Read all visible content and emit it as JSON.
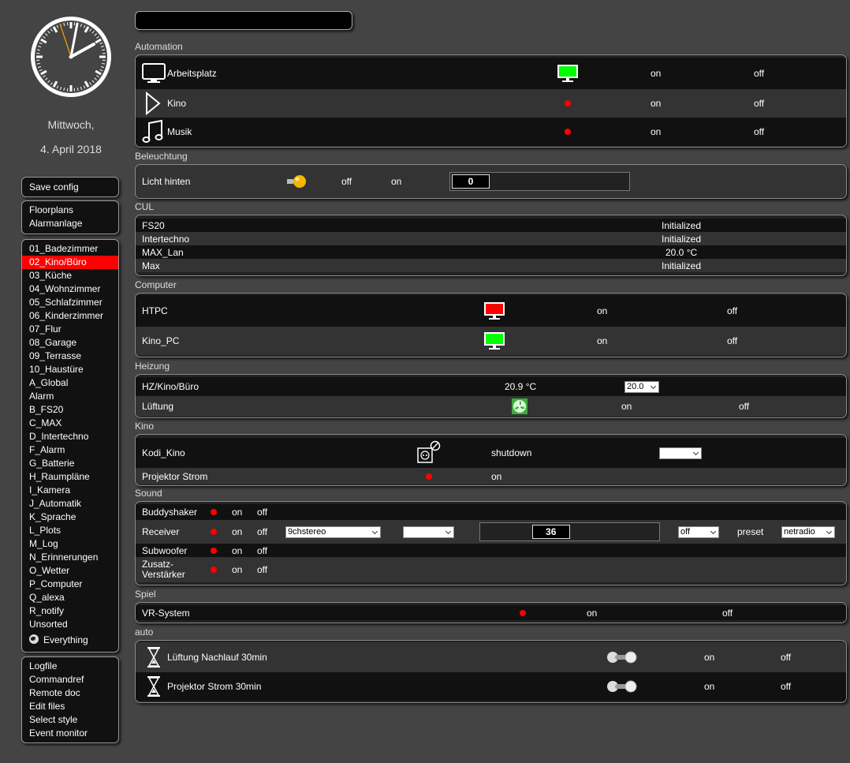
{
  "sidebar": {
    "date": {
      "weekday": "Mittwoch,",
      "date": "4. April 2018"
    },
    "menu_save": [
      "Save config"
    ],
    "menu_top": [
      "Floorplans",
      "Alarmanlage"
    ],
    "rooms": [
      "01_Badezimmer",
      "02_Kino/Büro",
      "03_Küche",
      "04_Wohnzimmer",
      "05_Schlafzimmer",
      "06_Kinderzimmer",
      "07_Flur",
      "08_Garage",
      "09_Terrasse",
      "10_Haustüre",
      "A_Global",
      "Alarm",
      "B_FS20",
      "C_MAX",
      "D_Intertechno",
      "F_Alarm",
      "G_Batterie",
      "H_Raumpläne",
      "I_Kamera",
      "J_Automatik",
      "K_Sprache",
      "L_Plots",
      "M_Log",
      "N_Erinnerungen",
      "O_Wetter",
      "P_Computer",
      "Q_alexa",
      "R_notify",
      "Unsorted"
    ],
    "selected_room": "02_Kino/Büro",
    "everything": "Everything",
    "menu_bottom": [
      "Logfile",
      "Commandref",
      "Remote doc",
      "Edit files",
      "Select style",
      "Event monitor"
    ]
  },
  "search": {
    "value": ""
  },
  "groups": {
    "automation": {
      "title": "Automation",
      "rows": [
        {
          "name": "Arbeitsplatz",
          "on": "on",
          "off": "off"
        },
        {
          "name": "Kino",
          "on": "on",
          "off": "off"
        },
        {
          "name": "Musik",
          "on": "on",
          "off": "off"
        }
      ]
    },
    "beleuchtung": {
      "title": "Beleuchtung",
      "row": {
        "name": "Licht hinten",
        "off": "off",
        "on": "on",
        "slider_value": "0",
        "slider_level": 0
      }
    },
    "cul": {
      "title": "CUL",
      "rows": [
        {
          "name": "FS20",
          "state": "Initialized"
        },
        {
          "name": "Intertechno",
          "state": "Initialized"
        },
        {
          "name": "MAX_Lan",
          "state": "20.0 °C"
        },
        {
          "name": "Max",
          "state": "Initialized"
        }
      ]
    },
    "computer": {
      "title": "Computer",
      "rows": [
        {
          "name": "HTPC",
          "on": "on",
          "off": "off",
          "screen_color": "#ff0000"
        },
        {
          "name": "Kino_PC",
          "on": "on",
          "off": "off",
          "screen_color": "#00ff00"
        }
      ]
    },
    "heizung": {
      "title": "Heizung",
      "rows": [
        {
          "name": "HZ/Kino/Büro",
          "temp": "20.9 °C",
          "desired": "20.0"
        },
        {
          "name": "Lüftung",
          "on": "on",
          "off": "off"
        }
      ]
    },
    "kino": {
      "title": "Kino",
      "rows": [
        {
          "name": "Kodi_Kino",
          "state": "shutdown",
          "select": ""
        },
        {
          "name": "Projektor Strom",
          "state": "on"
        }
      ]
    },
    "sound": {
      "title": "Sound",
      "rows": [
        {
          "name": "Buddyshaker",
          "on": "on",
          "off": "off"
        },
        {
          "name": "Receiver",
          "on": "on",
          "off": "off",
          "input": "9chstereo",
          "select2": "",
          "volume": "36",
          "volume_level": 0.36,
          "mute": "off",
          "preset_label": "preset",
          "preset": "netradio"
        },
        {
          "name": "Subwoofer",
          "on": "on",
          "off": "off"
        },
        {
          "name": "Zusatz-\nVerstärker",
          "name1": "Zusatz-",
          "name2": "Verstärker",
          "on": "on",
          "off": "off"
        }
      ]
    },
    "spiel": {
      "title": "Spiel",
      "row": {
        "name": "VR-System",
        "on": "on",
        "off": "off"
      }
    },
    "auto": {
      "title": "auto",
      "rows": [
        {
          "name": "Lüftung Nachlauf 30min",
          "on": "on",
          "off": "off"
        },
        {
          "name": "Projektor Strom 30min",
          "on": "on",
          "off": "off"
        }
      ]
    }
  },
  "colors": {
    "background": "#444444",
    "selected": "#ff0000",
    "status_red": "#ff0000",
    "screen_green": "#00ff00",
    "lamp_yellow": "#f5b800"
  },
  "icons": [
    "clock-icon",
    "monitor-icon",
    "play-icon",
    "music-note-icon",
    "bulb-icon",
    "fan-icon",
    "socket-icon",
    "hourglass-icon",
    "toggle-icon",
    "globe-icon"
  ]
}
